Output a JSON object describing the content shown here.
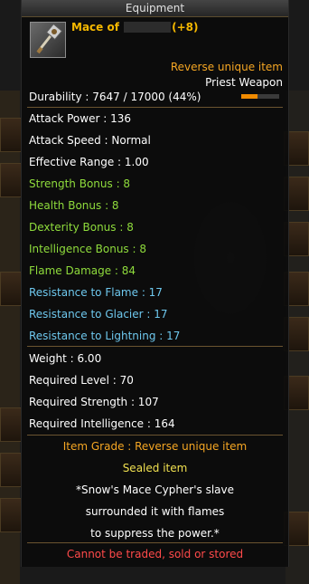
{
  "window": {
    "title": "Equipment"
  },
  "item": {
    "name_prefix": "Mace of ",
    "name_suffix": "(+8)",
    "grade_label": "Reverse unique item",
    "class_label": "Priest Weapon",
    "durability_text": "Durability : 7647 / 17000 (44%)",
    "durability_fraction": 0.44
  },
  "stats": [
    {
      "text": "Attack Power : 136",
      "color": "white"
    },
    {
      "text": "Attack Speed : Normal",
      "color": "white"
    },
    {
      "text": "Effective Range : 1.00",
      "color": "white"
    },
    {
      "text": "Strength Bonus : 8",
      "color": "green"
    },
    {
      "text": "Health Bonus : 8",
      "color": "green"
    },
    {
      "text": "Dexterity Bonus : 8",
      "color": "green"
    },
    {
      "text": "Intelligence Bonus : 8",
      "color": "green"
    },
    {
      "text": "Flame Damage : 84",
      "color": "green"
    },
    {
      "text": "Resistance to Flame : 17",
      "color": "blue"
    },
    {
      "text": "Resistance to Glacier : 17",
      "color": "blue"
    },
    {
      "text": "Resistance to Lightning : 17",
      "color": "blue"
    }
  ],
  "requirements": [
    "Weight : 6.00",
    "Required Level : 70",
    "Required Strength : 107",
    "Required Intelligence : 164"
  ],
  "footer": {
    "item_grade": "Item Grade : Reverse unique item",
    "sealed": "Sealed item",
    "lore": [
      "*Snow's Mace Cypher's slave",
      "surrounded it with flames",
      "to suppress the power.*"
    ],
    "restriction": "Cannot be traded, sold or stored"
  },
  "colors": {
    "white": "#ffffff",
    "green": "#8fdc3c",
    "blue": "#6ec8ee",
    "gold": "#f5a623",
    "yellow": "#f0e050",
    "red": "#ff4a4a",
    "name": "#f5b800"
  },
  "icons": {
    "item": "mace-icon"
  }
}
